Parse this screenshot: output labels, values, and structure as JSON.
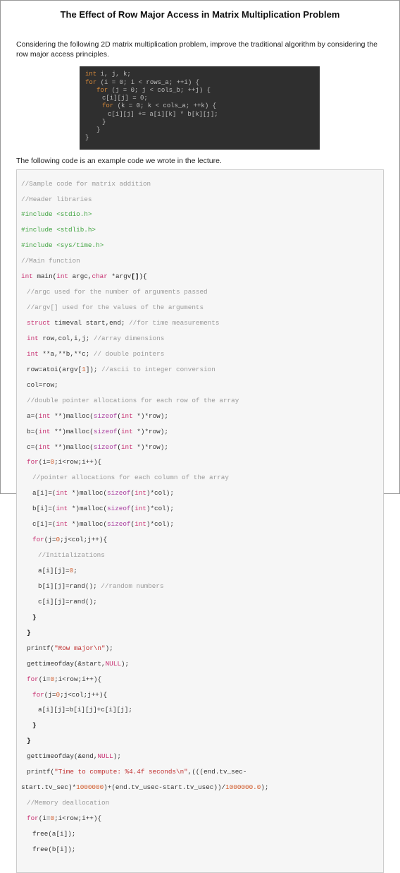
{
  "title": "The Effect of Row Major Access in Matrix Multiplication Problem",
  "intro": "Considering the following 2D matrix multiplication problem, improve the traditional algorithm by considering the row major access principles.",
  "dark_code": {
    "l1": {
      "kw": "int",
      "rest": " i, j, k;"
    },
    "l2": {
      "kw": "for",
      "body": " (i = 0; i < rows_a; ++i) {"
    },
    "l3": {
      "kw": "for",
      "body": " (j = 0; j < cols_b; ++j) {"
    },
    "l4": "c[i][j] = 0;",
    "l5": {
      "kw": "for",
      "body": " (k = 0; k < cols_a; ++k) {"
    },
    "l6": "c[i][j] += a[i][k] * b[k][j];",
    "l7": "}",
    "l8": "}",
    "l9": "}"
  },
  "between": "The following code is an example code we wrote in the lecture.",
  "code": {
    "c01": "//Sample code for matrix addition",
    "c02": "//Header libraries",
    "c03a": "#include ",
    "c03b": "<stdio.h>",
    "c04a": "#include ",
    "c04b": "<stdlib.h>",
    "c05a": "#include ",
    "c05b": "<sys/time.h>",
    "c06": "//Main function",
    "c07_int": "int",
    "c07_main": " main",
    "c07_sig1": "(",
    "c07_sig2": "int",
    "c07_sig3": " argc,",
    "c07_sig4": "char",
    "c07_sig5": " *argv",
    "c07_sig6": "[]",
    "c07_sig7": "){",
    "c08": "//argc used for the number of arguments passed",
    "c09": "//argv[] used for the values of the arguments",
    "c10a": "struct",
    "c10b": " timeval start,end; ",
    "c10c": "//for time measurements",
    "c11a": "int",
    "c11b": " row,col,i,j; ",
    "c11c": "//array dimensions",
    "c12a": "int",
    "c12b": " **a,**b,**c; ",
    "c12c": "// double pointers",
    "c13a": "row=atoi(argv[",
    "c13n": "1",
    "c13b": "]); ",
    "c13c": "//ascii to integer conversion",
    "c14": "col=row;",
    "c15": "//double pointer allocations for each row of the array",
    "c16a": "a=(",
    "c16b": "int",
    "c16c": " **)malloc(",
    "c16d": "sizeof",
    "c16e": "(",
    "c16f": "int",
    "c16g": " *)*row);",
    "c17a": "b=(",
    "c17b": "int",
    "c17c": " **)malloc(",
    "c17d": "sizeof",
    "c17e": "(",
    "c17f": "int",
    "c17g": " *)*row);",
    "c18a": "c=(",
    "c18b": "int",
    "c18c": " **)malloc(",
    "c18d": "sizeof",
    "c18e": "(",
    "c18f": "int",
    "c18g": " *)*row);",
    "c19a": "for",
    "c19b": "(i=",
    "c19n": "0",
    "c19c": ";i<row;i++){",
    "c20": "//pointer allocations for each column of the array",
    "c21a": "a[i]=(",
    "c21b": "int",
    "c21c": " *)malloc(",
    "c21d": "sizeof",
    "c21e": "(",
    "c21f": "int",
    "c21g": ")*col);",
    "c22a": "b[i]=(",
    "c22b": "int",
    "c22c": " *)malloc(",
    "c22d": "sizeof",
    "c22e": "(",
    "c22f": "int",
    "c22g": ")*col);",
    "c23a": "c[i]=(",
    "c23b": "int",
    "c23c": " *)malloc(",
    "c23d": "sizeof",
    "c23e": "(",
    "c23f": "int",
    "c23g": ")*col);",
    "c24a": "for",
    "c24b": "(j=",
    "c24n": "0",
    "c24c": ";j<col;j++){",
    "c25": "//Initializations",
    "c26a": "a[i][j]=",
    "c26n": "0",
    "c26b": ";",
    "c27a": "b[i][j]=rand(); ",
    "c27c": "//random numbers",
    "c28": "c[i][j]=rand();",
    "c29": "}",
    "c30": "}",
    "c31a": "printf(",
    "c31s": "\"Row major\\n\"",
    "c31b": ");",
    "c32a": "gettimeofday(&start,",
    "c32n": "NULL",
    "c32b": ");",
    "c33a": "for",
    "c33b": "(i=",
    "c33n": "0",
    "c33c": ";i<row;i++){",
    "c34a": "for",
    "c34b": "(j=",
    "c34n": "0",
    "c34c": ";j<col;j++){",
    "c35": "a[i][j]=b[i][j]+c[i][j];",
    "c36": "}",
    "c37": "}",
    "c38a": "gettimeofday(&end,",
    "c38n": "NULL",
    "c38b": ");",
    "c39a": "printf(",
    "c39s": "\"Time to compute: %4.4f seconds\\n\"",
    "c39b": ",(((end.tv_sec-",
    "c40a": "start.tv_sec)*",
    "c40n1": "1000000",
    "c40b": ")+(end.tv_usec-start.tv_usec))/",
    "c40n2": "1000000.0",
    "c40c": ");",
    "c41": "//Memory deallocation",
    "c42a": "for",
    "c42b": "(i=",
    "c42n": "0",
    "c42c": ";i<row;i++){",
    "c43": "free(a[i]);",
    "c44": "free(b[i]);"
  }
}
